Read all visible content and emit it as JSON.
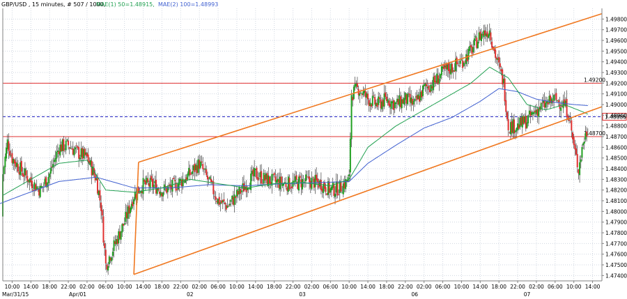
{
  "header": {
    "symbol_info": "GBP/USD , 15 minutes, # 507 / 1000,",
    "ma1_label": "MAE(1) 50=1.48915,",
    "ma2_label": "MAE(2) 100=1.48993"
  },
  "chart_data": {
    "type": "candlestick",
    "instrument": "GBP/USD",
    "timeframe": "15 minutes",
    "y_range": [
      1.4735,
      1.499
    ],
    "y_ticks": [
      "1.49800",
      "1.49700",
      "1.49600",
      "1.49500",
      "1.49400",
      "1.49300",
      "1.49200",
      "1.49100",
      "1.49000",
      "1.48900",
      "1.48800",
      "1.48700",
      "1.48600",
      "1.48500",
      "1.48400",
      "1.48300",
      "1.48200",
      "1.48100",
      "1.48000",
      "1.47900",
      "1.47800",
      "1.47700",
      "1.47600",
      "1.47500",
      "1.47400"
    ],
    "time_ticks": [
      {
        "label": "10:00",
        "hour": 10
      },
      {
        "label": "14:00",
        "hour": 14
      },
      {
        "label": "18:00",
        "hour": 18
      },
      {
        "label": "22:00",
        "hour": 22
      },
      {
        "label": "02:00",
        "hour": 26
      },
      {
        "label": "06:00",
        "hour": 30
      },
      {
        "label": "10:00",
        "hour": 34
      },
      {
        "label": "14:00",
        "hour": 38
      },
      {
        "label": "18:00",
        "hour": 42
      },
      {
        "label": "22:00",
        "hour": 46
      },
      {
        "label": "02:00",
        "hour": 50
      },
      {
        "label": "06:00",
        "hour": 54
      },
      {
        "label": "10:00",
        "hour": 58
      },
      {
        "label": "14:00",
        "hour": 62
      },
      {
        "label": "18:00",
        "hour": 66
      },
      {
        "label": "22:00",
        "hour": 70
      },
      {
        "label": "02:00",
        "hour": 74
      },
      {
        "label": "06:00",
        "hour": 78
      },
      {
        "label": "10:00",
        "hour": 82
      },
      {
        "label": "14:00",
        "hour": 86
      },
      {
        "label": "18:00",
        "hour": 90
      },
      {
        "label": "22:00",
        "hour": 94
      },
      {
        "label": "02:00",
        "hour": 98
      },
      {
        "label": "06:00",
        "hour": 102
      },
      {
        "label": "10:00",
        "hour": 106
      },
      {
        "label": "14:00",
        "hour": 110
      },
      {
        "label": "18:00",
        "hour": 114
      },
      {
        "label": "22:00",
        "hour": 118
      },
      {
        "label": "02:00",
        "hour": 122
      },
      {
        "label": "06:00",
        "hour": 126
      },
      {
        "label": "10:00",
        "hour": 130
      },
      {
        "label": "14:00",
        "hour": 134
      }
    ],
    "date_ticks": [
      {
        "label": "Mar/31/15",
        "hour": 8
      },
      {
        "label": "Apr/01",
        "hour": 24
      },
      {
        "label": "02",
        "hour": 48
      },
      {
        "label": "03",
        "hour": 72
      },
      {
        "label": "06",
        "hour": 96
      },
      {
        "label": "07",
        "hour": 120
      }
    ],
    "horizontal_levels": [
      {
        "value": 1.492,
        "label": "1.49200",
        "color": "#e03030"
      },
      {
        "value": 1.487,
        "label": "1.48700",
        "color": "#e03030"
      }
    ],
    "current_price": {
      "value": 1.48886,
      "label": "1.48886",
      "color": "#2020c0"
    },
    "channel_lines": [
      {
        "name": "upper-channel",
        "color": "#f07820",
        "points": [
          [
            37,
            1.4846
          ],
          [
            136,
            1.4985
          ]
        ]
      },
      {
        "name": "lower-channel",
        "color": "#f07820",
        "points": [
          [
            36,
            1.4741
          ],
          [
            136,
            1.4898
          ]
        ]
      },
      {
        "name": "channel-start",
        "color": "#f07820",
        "points": [
          [
            37,
            1.4846
          ],
          [
            36,
            1.4741
          ]
        ]
      }
    ],
    "candle_anchors": [
      [
        0,
        1.4795
      ],
      [
        2,
        1.477
      ],
      [
        4,
        1.4785
      ],
      [
        6,
        1.48
      ],
      [
        8,
        1.4835
      ],
      [
        9,
        1.4865
      ],
      [
        10,
        1.485
      ],
      [
        12,
        1.4838
      ],
      [
        14,
        1.4828
      ],
      [
        16,
        1.482
      ],
      [
        18,
        1.4835
      ],
      [
        20,
        1.486
      ],
      [
        22,
        1.4862
      ],
      [
        24,
        1.4855
      ],
      [
        26,
        1.485
      ],
      [
        28,
        1.483
      ],
      [
        29,
        1.4805
      ],
      [
        30,
        1.475
      ],
      [
        32,
        1.477
      ],
      [
        34,
        1.479
      ],
      [
        36,
        1.4815
      ],
      [
        38,
        1.4825
      ],
      [
        40,
        1.4825
      ],
      [
        42,
        1.482
      ],
      [
        44,
        1.4822
      ],
      [
        46,
        1.4828
      ],
      [
        48,
        1.4835
      ],
      [
        50,
        1.4845
      ],
      [
        52,
        1.4828
      ],
      [
        54,
        1.481
      ],
      [
        56,
        1.4805
      ],
      [
        58,
        1.4815
      ],
      [
        60,
        1.4825
      ],
      [
        62,
        1.4835
      ],
      [
        64,
        1.483
      ],
      [
        66,
        1.4828
      ],
      [
        68,
        1.4826
      ],
      [
        70,
        1.4826
      ],
      [
        72,
        1.4828
      ],
      [
        74,
        1.4828
      ],
      [
        76,
        1.4826
      ],
      [
        78,
        1.482
      ],
      [
        80,
        1.4822
      ],
      [
        82,
        1.483
      ],
      [
        82.5,
        1.491
      ],
      [
        84,
        1.4915
      ],
      [
        86,
        1.4905
      ],
      [
        88,
        1.49
      ],
      [
        90,
        1.4905
      ],
      [
        92,
        1.49
      ],
      [
        94,
        1.4905
      ],
      [
        96,
        1.49
      ],
      [
        98,
        1.4915
      ],
      [
        100,
        1.492
      ],
      [
        102,
        1.493
      ],
      [
        104,
        1.4935
      ],
      [
        106,
        1.494
      ],
      [
        108,
        1.495
      ],
      [
        110,
        1.4965
      ],
      [
        112,
        1.497
      ],
      [
        113,
        1.495
      ],
      [
        114,
        1.4935
      ],
      [
        115,
        1.492
      ],
      [
        116,
        1.488
      ],
      [
        118,
        1.488
      ],
      [
        120,
        1.4885
      ],
      [
        122,
        1.4895
      ],
      [
        124,
        1.49
      ],
      [
        126,
        1.4905
      ],
      [
        128,
        1.49
      ],
      [
        129,
        1.489
      ],
      [
        130,
        1.486
      ],
      [
        131,
        1.484
      ],
      [
        132,
        1.4865
      ],
      [
        133,
        1.4878
      ]
    ],
    "ma1_anchors": [
      [
        8,
        1.4815
      ],
      [
        14,
        1.483
      ],
      [
        20,
        1.4845
      ],
      [
        26,
        1.4848
      ],
      [
        30,
        1.482
      ],
      [
        36,
        1.4818
      ],
      [
        42,
        1.4822
      ],
      [
        48,
        1.483
      ],
      [
        54,
        1.4826
      ],
      [
        60,
        1.4822
      ],
      [
        66,
        1.4826
      ],
      [
        72,
        1.4827
      ],
      [
        78,
        1.4824
      ],
      [
        82,
        1.483
      ],
      [
        86,
        1.486
      ],
      [
        92,
        1.488
      ],
      [
        98,
        1.4895
      ],
      [
        104,
        1.491
      ],
      [
        108,
        1.492
      ],
      [
        112,
        1.4935
      ],
      [
        116,
        1.4925
      ],
      [
        120,
        1.49
      ],
      [
        124,
        1.4895
      ],
      [
        128,
        1.49
      ],
      [
        132,
        1.4893
      ],
      [
        133,
        1.4891
      ]
    ],
    "ma2_anchors": [
      [
        0,
        1.481
      ],
      [
        6,
        1.4805
      ],
      [
        12,
        1.4815
      ],
      [
        20,
        1.4828
      ],
      [
        28,
        1.4832
      ],
      [
        36,
        1.4822
      ],
      [
        44,
        1.4822
      ],
      [
        52,
        1.4825
      ],
      [
        60,
        1.4824
      ],
      [
        68,
        1.4826
      ],
      [
        76,
        1.4827
      ],
      [
        82,
        1.4828
      ],
      [
        86,
        1.4845
      ],
      [
        92,
        1.4862
      ],
      [
        98,
        1.4878
      ],
      [
        104,
        1.4888
      ],
      [
        110,
        1.4903
      ],
      [
        114,
        1.4915
      ],
      [
        118,
        1.4912
      ],
      [
        122,
        1.4905
      ],
      [
        126,
        1.4902
      ],
      [
        130,
        1.49
      ],
      [
        133,
        1.4899
      ]
    ],
    "colors": {
      "bull": "#20a020",
      "bear": "#e03030",
      "wick": "#404040",
      "ma1": "#20a050",
      "ma2": "#4060d0",
      "grid": "#cfd6e0",
      "axis": "#808080"
    }
  }
}
